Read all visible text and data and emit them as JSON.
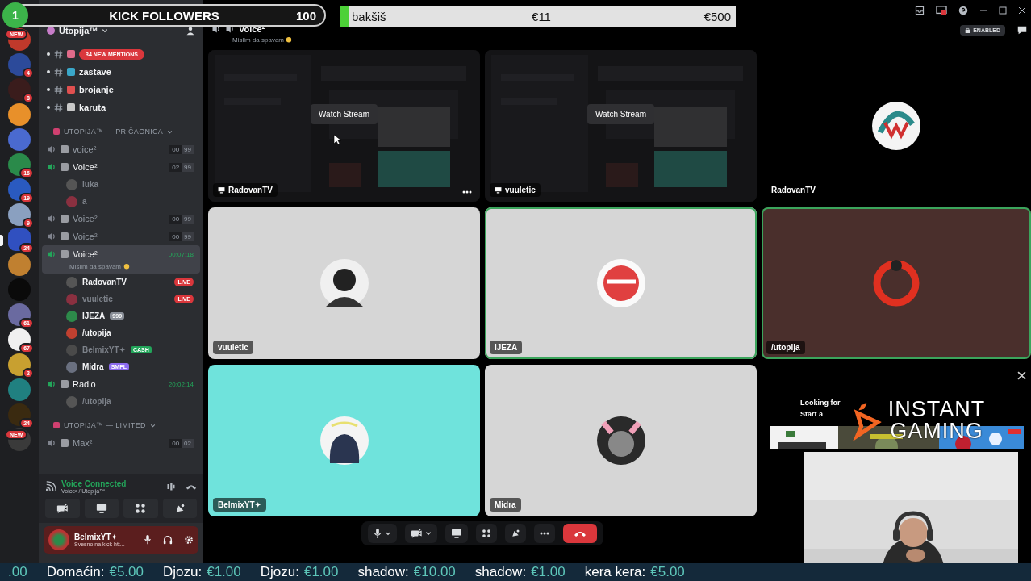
{
  "overlay": {
    "kick_goal": {
      "count": "1",
      "label": "KICK FOLLOWERS",
      "target": "100"
    },
    "tip_goal": {
      "label": "bakšiš",
      "current": "€11",
      "target": "€500",
      "level": 0.022
    }
  },
  "servers": [
    {
      "color": "#c0392b",
      "badge": "NEW",
      "selected": false
    },
    {
      "color": "#2c4a9a",
      "badge": "4",
      "selected": false
    },
    {
      "color": "#3a1c1c",
      "badge": "8",
      "selected": false
    },
    {
      "color": "#e8902a",
      "selected": false
    },
    {
      "color": "#4a6ad0",
      "selected": false
    },
    {
      "color": "#2a8a4a",
      "badge": "16",
      "selected": false
    },
    {
      "color": "#2a5ac0",
      "badge": "19",
      "selected": false
    },
    {
      "color": "#8aa0c0",
      "badge": "9",
      "selected": false
    },
    {
      "color": "#3050c0",
      "badge": "24",
      "selected": true
    },
    {
      "color": "#c08030",
      "selected": false
    },
    {
      "color": "#0a0a0a",
      "selected": false
    },
    {
      "color": "#6a6aa0",
      "badge": "61",
      "selected": false
    },
    {
      "color": "#f0f0f0",
      "badge": "67",
      "selected": false
    },
    {
      "color": "#c8a030",
      "badge": "2",
      "selected": false
    },
    {
      "color": "#208080",
      "selected": false
    },
    {
      "color": "#3a2a10",
      "badge": "24",
      "selected": false
    },
    {
      "color": "#3a3a3a",
      "badge": "NEW",
      "selected": false
    }
  ],
  "sidebar": {
    "server_name": "Utopija™",
    "channels": [
      {
        "kind": "text",
        "unread": true,
        "mentions": "34 NEW MENTIONS"
      },
      {
        "kind": "text",
        "unread": true,
        "name": "zastave"
      },
      {
        "kind": "text",
        "unread": true,
        "name": "brojanje"
      },
      {
        "kind": "text",
        "unread": true,
        "name": "karuta"
      },
      {
        "kind": "category",
        "name": "UTOPIJA™ — PRIČAONICA"
      },
      {
        "kind": "voice",
        "name": "voice²",
        "active": false,
        "selected": false,
        "limit": [
          "00",
          "99"
        ]
      },
      {
        "kind": "voice",
        "name": "Voice²",
        "active": true,
        "selected": false,
        "limit": [
          "02",
          "99"
        ],
        "members": [
          {
            "name": "luka",
            "dim": true
          },
          {
            "name": "a",
            "dim": true
          }
        ]
      },
      {
        "kind": "voice",
        "name": "Voice²",
        "active": false,
        "selected": false,
        "limit": [
          "00",
          "99"
        ]
      },
      {
        "kind": "voice",
        "name": "Voice²",
        "active": false,
        "selected": false,
        "limit": [
          "00",
          "99"
        ]
      },
      {
        "kind": "voice",
        "name": "Voice²",
        "active": true,
        "selected": true,
        "timer": "00:07:18",
        "status": "Mislim da spavam",
        "members": [
          {
            "name": "RadovanTV",
            "dim": false,
            "tags": [
              {
                "kind": "live",
                "text": "LIVE"
              }
            ]
          },
          {
            "name": "vuuletic",
            "dim": true,
            "tags": [
              {
                "kind": "live",
                "text": "LIVE"
              }
            ]
          },
          {
            "name": "IJEZA",
            "dim": false,
            "tags": [
              {
                "kind": "role",
                "text": "999",
                "color": "#8a8f98"
              }
            ]
          },
          {
            "name": "/utopija",
            "dim": false
          },
          {
            "name": "BelmixYT✦",
            "dim": true,
            "tags": [
              {
                "kind": "role",
                "text": "CASH",
                "color": "#23a55a"
              }
            ]
          },
          {
            "name": "Midra",
            "dim": false,
            "tags": [
              {
                "kind": "role",
                "text": "SMPL",
                "color": "#8d6cf0"
              }
            ]
          }
        ]
      },
      {
        "kind": "voice",
        "name": "Radio",
        "active": true,
        "selected": false,
        "timer": "20:02:14",
        "members": [
          {
            "name": "/utopija",
            "dim": true
          }
        ]
      },
      {
        "kind": "category",
        "name": "UTOPIJA™ — LIMITED"
      },
      {
        "kind": "voice",
        "name": "Max²",
        "active": false,
        "selected": false,
        "limit": [
          "00",
          "02"
        ]
      }
    ]
  },
  "voice_panel": {
    "title": "Voice Connected",
    "channel": "Voice² / Utopija™"
  },
  "user_panel": {
    "name": "BelmixYT✦",
    "status": "Svesno na kick htt..."
  },
  "call": {
    "channel": "Voice²",
    "status": "Mislim da spavam",
    "badge": "ENABLED",
    "tiles": [
      {
        "kind": "stream",
        "name": "RadovanTV",
        "action": "Watch Stream"
      },
      {
        "kind": "stream",
        "name": "vuuletic",
        "action": "Watch Stream"
      },
      {
        "kind": "user",
        "name": "RadovanTV",
        "color": "#000000",
        "speaking": false
      },
      {
        "kind": "user",
        "name": "vuuletic",
        "color": "#d6d6d6",
        "speaking": false
      },
      {
        "kind": "user",
        "name": "IJEZA",
        "color": "#d6d6d6",
        "speaking": true
      },
      {
        "kind": "user",
        "name": "/utopija",
        "color": "#4a2f2c",
        "speaking": true
      },
      {
        "kind": "user",
        "name": "BelmixYT✦",
        "color": "#6fe3dc",
        "speaking": false
      },
      {
        "kind": "user",
        "name": "Midra",
        "color": "#d6d6d6",
        "speaking": false
      },
      {
        "kind": "activity",
        "lines": [
          "Looking for",
          "Start a"
        ]
      }
    ]
  },
  "sponsor": {
    "name": "INSTANT GAMING"
  },
  "ticker": [
    {
      "amount": ".00"
    },
    {
      "name": "Domaćin:",
      "amount": "€5.00"
    },
    {
      "name": "Djozu:",
      "amount": "€1.00"
    },
    {
      "name": "Djozu:",
      "amount": "€1.00"
    },
    {
      "name": "shadow:",
      "amount": "€10.00"
    },
    {
      "name": "shadow:",
      "amount": "€1.00"
    },
    {
      "name": "kera kera:",
      "amount": "€5.00"
    }
  ]
}
